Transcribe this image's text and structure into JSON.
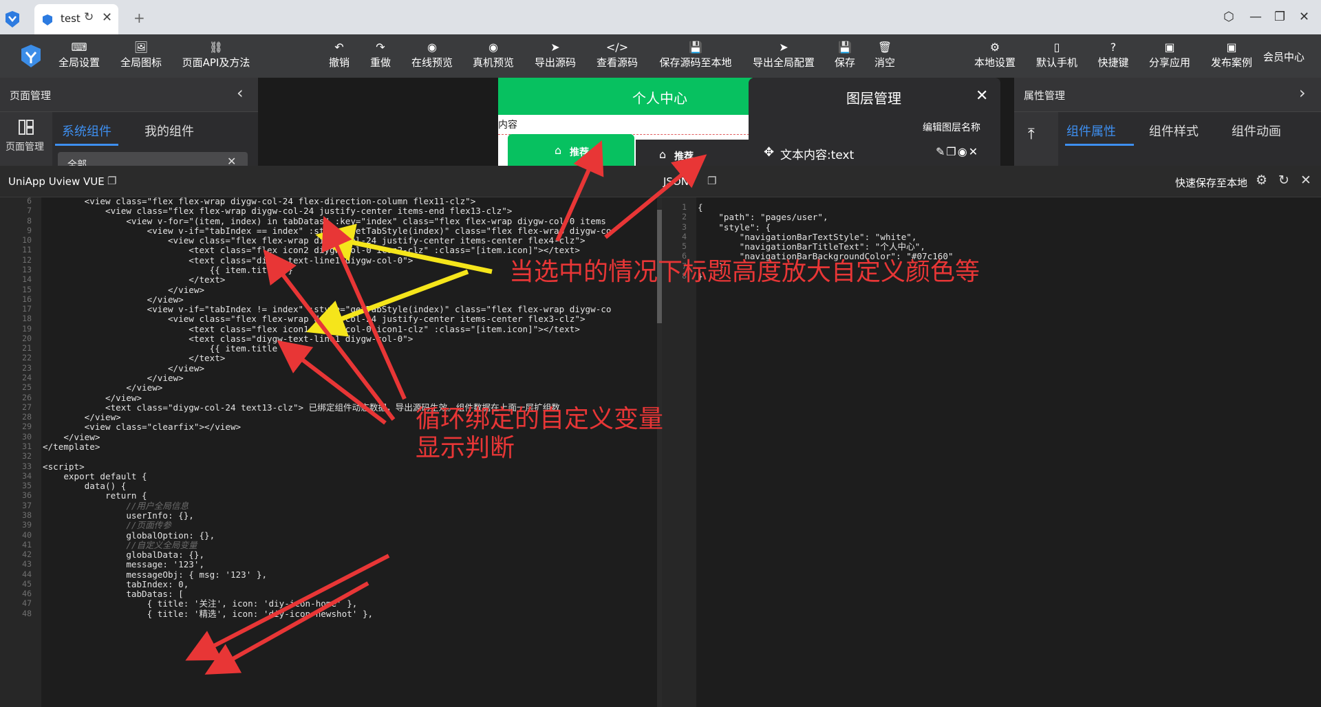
{
  "browser": {
    "tab_title": "test",
    "reload_icon": "reload-icon",
    "close_icon": "close-icon",
    "new_tab_glyph": "+"
  },
  "toolbar": {
    "items": [
      {
        "label": "全局设置",
        "icon": "settings-code-icon"
      },
      {
        "label": "全局图标",
        "icon": "image-icon"
      },
      {
        "label": "页面API及方法",
        "icon": "link-icon"
      },
      {
        "label": "撤销",
        "icon": "undo-icon"
      },
      {
        "label": "重做",
        "icon": "redo-icon"
      },
      {
        "label": "在线预览",
        "icon": "eye-icon"
      },
      {
        "label": "真机预览",
        "icon": "eye-icon"
      },
      {
        "label": "导出源码",
        "icon": "send-icon"
      },
      {
        "label": "查看源码",
        "icon": "code-icon"
      },
      {
        "label": "保存源码至本地",
        "icon": "save-icon"
      },
      {
        "label": "导出全局配置",
        "icon": "send-icon"
      },
      {
        "label": "保存",
        "icon": "save-icon"
      },
      {
        "label": "消空",
        "icon": "trash-icon"
      },
      {
        "label": "本地设置",
        "icon": "gear-icon"
      },
      {
        "label": "默认手机",
        "icon": "phone-icon"
      },
      {
        "label": "快捷键",
        "icon": "help-icon"
      },
      {
        "label": "分享应用",
        "icon": "share-icon"
      },
      {
        "label": "发布案例",
        "icon": "publish-icon"
      }
    ],
    "member": "会员中心"
  },
  "left_panel": {
    "title": "页面管理",
    "side_label": "页面管理",
    "tabs": [
      "系统组件",
      "我的组件"
    ],
    "select_value": "全部"
  },
  "phone": {
    "nav_title": "个人中心",
    "content_label": "内容",
    "tab1": "推荐",
    "tab2": "推荐"
  },
  "layer_panel": {
    "title": "图层管理",
    "edit_label": "编辑图层名称",
    "item": "文本内容:text"
  },
  "right_panel": {
    "title": "属性管理",
    "tabs": [
      "组件属性",
      "组件样式",
      "组件动画"
    ]
  },
  "editor": {
    "left_title": "UniApp Uview VUE",
    "right_title": "JSON",
    "save_local": "快速保存至本地"
  },
  "code_lines": [
    {
      "n": "6",
      "t": "        <view class=\"flex flex-wrap diygw-col-24 flex-direction-column flex11-clz\">"
    },
    {
      "n": "7",
      "t": "            <view class=\"flex flex-wrap diygw-col-24 justify-center items-end flex13-clz\">"
    },
    {
      "n": "8",
      "t": "                <view v-for=\"(item, index) in tabDatas\" :key=\"index\" class=\"flex flex-wrap diygw-col-0 items"
    },
    {
      "n": "9",
      "t": "                    <view v-if=\"tabIndex == index\" :style=\"getTabStyle(index)\" class=\"flex flex-wrap diygw-co"
    },
    {
      "n": "10",
      "t": "                        <view class=\"flex flex-wrap diygw-col-24 justify-center items-center flex4-clz\">"
    },
    {
      "n": "11",
      "t": "                            <text class=\"flex icon2 diygw-col-0 icon2-clz\" :class=\"[item.icon]\"></text>"
    },
    {
      "n": "12",
      "t": "                            <text class=\"diygw-text-line1 diygw-col-0\">"
    },
    {
      "n": "13",
      "t": "                                {{ item.title }}"
    },
    {
      "n": "14",
      "t": "                            </text>"
    },
    {
      "n": "15",
      "t": "                        </view>"
    },
    {
      "n": "16",
      "t": "                    </view>"
    },
    {
      "n": "17",
      "t": "                    <view v-if=\"tabIndex != index\" :style=\"getTabStyle(index)\" class=\"flex flex-wrap diygw-co"
    },
    {
      "n": "18",
      "t": "                        <view class=\"flex flex-wrap diygw-col-24 justify-center items-center flex3-clz\">"
    },
    {
      "n": "19",
      "t": "                            <text class=\"flex icon1 diygw-col-0 icon1-clz\" :class=\"[item.icon]\"></text>"
    },
    {
      "n": "20",
      "t": "                            <text class=\"diygw-text-line1 diygw-col-0\">"
    },
    {
      "n": "21",
      "t": "                                {{ item.title }}"
    },
    {
      "n": "22",
      "t": "                            </text>"
    },
    {
      "n": "23",
      "t": "                        </view>"
    },
    {
      "n": "24",
      "t": "                    </view>"
    },
    {
      "n": "25",
      "t": "                </view>"
    },
    {
      "n": "26",
      "t": "            </view>"
    },
    {
      "n": "27",
      "t": "            <text class=\"diygw-col-24 text13-clz\"> 已绑定组件动态数据，导出源码生效。组件数据在上面一层扩组数"
    },
    {
      "n": "28",
      "t": "        </view>"
    },
    {
      "n": "29",
      "t": "        <view class=\"clearfix\"></view>"
    },
    {
      "n": "30",
      "t": "    </view>"
    },
    {
      "n": "31",
      "t": "</template>"
    },
    {
      "n": "32",
      "t": ""
    },
    {
      "n": "33",
      "t": "<script>"
    },
    {
      "n": "34",
      "t": "    export default {"
    },
    {
      "n": "35",
      "t": "        data() {"
    },
    {
      "n": "36",
      "t": "            return {"
    },
    {
      "n": "37",
      "t": "                //用户全局信息"
    },
    {
      "n": "38",
      "t": "                userInfo: {},"
    },
    {
      "n": "39",
      "t": "                //页面传参"
    },
    {
      "n": "40",
      "t": "                globalOption: {},"
    },
    {
      "n": "41",
      "t": "                //自定义全局变量"
    },
    {
      "n": "42",
      "t": "                globalData: {},"
    },
    {
      "n": "43",
      "t": "                message: '123',"
    },
    {
      "n": "44",
      "t": "                messageObj: { msg: '123' },"
    },
    {
      "n": "45",
      "t": "                tabIndex: 0,"
    },
    {
      "n": "46",
      "t": "                tabDatas: ["
    },
    {
      "n": "47",
      "t": "                    { title: '关注', icon: 'diy-icon-home' },"
    },
    {
      "n": "48",
      "t": "                    { title: '精选', icon: 'diy-icon-newshot' },"
    }
  ],
  "json_lines": [
    {
      "n": "1",
      "t": "{"
    },
    {
      "n": "2",
      "t": "    \"path\": \"pages/user\","
    },
    {
      "n": "3",
      "t": "    \"style\": {"
    },
    {
      "n": "4",
      "t": "        \"navigationBarTextStyle\": \"white\","
    },
    {
      "n": "5",
      "t": "        \"navigationBarTitleText\": \"个人中心\","
    },
    {
      "n": "6",
      "t": "        \"navigationBarBackgroundColor\": \"#07c160\""
    },
    {
      "n": "7",
      "t": "    }"
    },
    {
      "n": "8",
      "t": "}"
    }
  ],
  "annotations": {
    "top": "当选中的情况下标题高度放大自定义颜色等",
    "mid_line1": "循环绑定的自定义变量",
    "mid_line2": "显示判断"
  },
  "colors": {
    "accent": "#3e8ff0",
    "brand_green": "#07c160",
    "annotation_red": "#e83636",
    "annotation_yellow": "#f5e51b",
    "toolbar_bg": "#3a3b3d"
  }
}
